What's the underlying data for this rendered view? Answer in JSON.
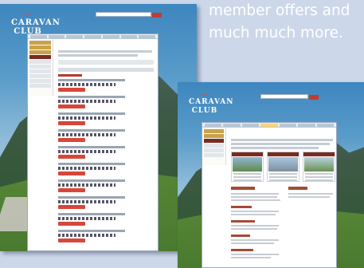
{
  "headline": {
    "line1": "member offers and",
    "line2": "much much more."
  },
  "back_screenshot": {
    "logo_line1": "CARAVAN",
    "logo_line2": "CLUB",
    "page_title": "",
    "result_count": 10
  },
  "front_screenshot": {
    "logo_line1": "CARAVAN",
    "logo_line2": "CLUB",
    "page_title": "",
    "card_count": 3
  },
  "colors": {
    "accent_red": "#d6473a",
    "nav_highlight": "#c9a24a",
    "nav_dark": "#7a2b22",
    "headline_text": "#ffffff"
  }
}
